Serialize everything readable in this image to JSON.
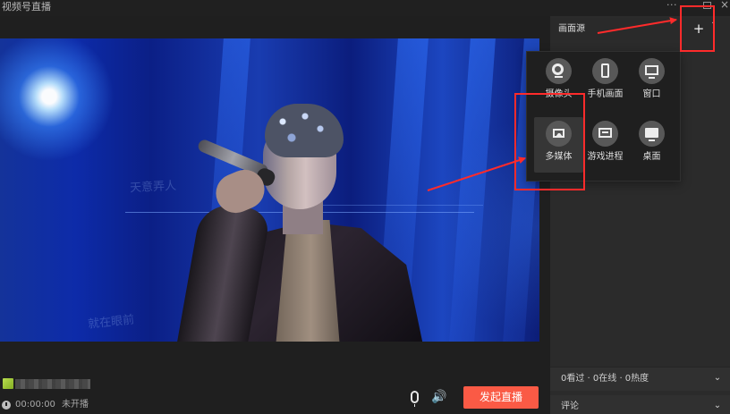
{
  "window": {
    "title": "视频号直播",
    "more_label": "···",
    "close_label": "×"
  },
  "preview": {
    "caption_1": "天意弄人",
    "caption_2": "就在眼前"
  },
  "sidebar": {
    "source_title": "画面源",
    "add_label": "+",
    "collapse_label": "ˆ",
    "options": [
      {
        "label": "摄像头",
        "icon": "camera-icon"
      },
      {
        "label": "手机画面",
        "icon": "phone-icon"
      },
      {
        "label": "窗口",
        "icon": "window-icon"
      },
      {
        "label": "多媒体",
        "icon": "media-icon"
      },
      {
        "label": "游戏进程",
        "icon": "game-icon"
      },
      {
        "label": "桌面",
        "icon": "desktop-icon"
      }
    ],
    "viewer_stats": "0看过 · 0在线 · 0热度",
    "comments_label": "评论",
    "expand_label": "⌄"
  },
  "bottom": {
    "time": "00:00:00",
    "status": "未开播",
    "go_live_label": "发起直播",
    "speaker_label": "🔊"
  },
  "colors": {
    "accent_red": "#fa5a45",
    "annotation_red": "#ff2b2b",
    "panel_background": "#2b2b2b"
  }
}
